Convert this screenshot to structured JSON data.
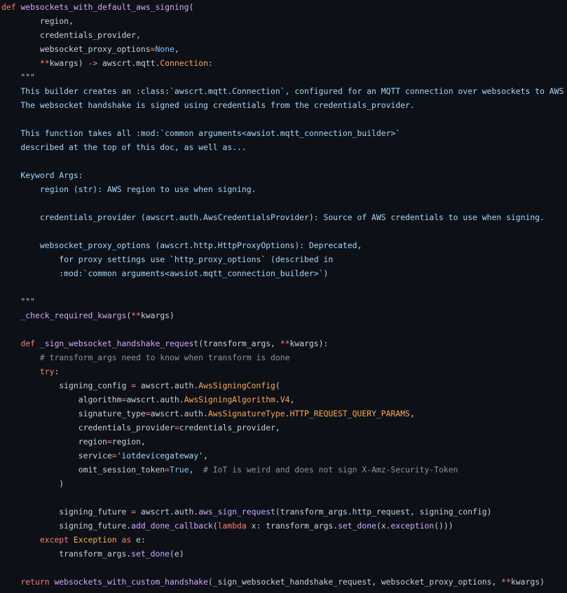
{
  "editor": {
    "background": "#0d1117",
    "token_colors": {
      "kw": "#ff7b72",
      "fn": "#d2a8ff",
      "txt": "#c9d1d9",
      "str": "#a5d6ff",
      "cmt": "#8b949e",
      "cst": "#79c0ff",
      "cls": "#ffa657"
    }
  },
  "lines": [
    [
      [
        "kw",
        "def"
      ],
      [
        "txt",
        " "
      ],
      [
        "fn",
        "websockets_with_default_aws_signing"
      ],
      [
        "txt",
        "("
      ]
    ],
    [
      [
        "txt",
        "        region,"
      ]
    ],
    [
      [
        "txt",
        "        credentials_provider,"
      ]
    ],
    [
      [
        "txt",
        "        websocket_proxy_options"
      ],
      [
        "kw",
        "="
      ],
      [
        "cst",
        "None"
      ],
      [
        "txt",
        ","
      ]
    ],
    [
      [
        "txt",
        "        "
      ],
      [
        "kw",
        "**"
      ],
      [
        "txt",
        "kwargs) "
      ],
      [
        "kw",
        "->"
      ],
      [
        "txt",
        " awscrt.mqtt."
      ],
      [
        "cls",
        "Connection"
      ],
      [
        "txt",
        ":"
      ]
    ],
    [
      [
        "str",
        "    \"\"\""
      ]
    ],
    [
      [
        "str",
        "    This builder creates an :class:`awscrt.mqtt.Connection`, configured for an MQTT connection over websockets to AWS IoT."
      ]
    ],
    [
      [
        "str",
        "    The websocket handshake is signed using credentials from the credentials_provider."
      ]
    ],
    [
      [
        "str",
        ""
      ]
    ],
    [
      [
        "str",
        "    This function takes all :mod:`common arguments<awsiot.mqtt_connection_builder>`"
      ]
    ],
    [
      [
        "str",
        "    described at the top of this doc, as well as..."
      ]
    ],
    [
      [
        "str",
        ""
      ]
    ],
    [
      [
        "str",
        "    Keyword Args:"
      ]
    ],
    [
      [
        "str",
        "        region (str): AWS region to use when signing."
      ]
    ],
    [
      [
        "str",
        ""
      ]
    ],
    [
      [
        "str",
        "        credentials_provider (awscrt.auth.AwsCredentialsProvider): Source of AWS credentials to use when signing."
      ]
    ],
    [
      [
        "str",
        ""
      ]
    ],
    [
      [
        "str",
        "        websocket_proxy_options (awscrt.http.HttpProxyOptions): Deprecated,"
      ]
    ],
    [
      [
        "str",
        "            for proxy settings use `http_proxy_options` (described in"
      ]
    ],
    [
      [
        "str",
        "            :mod:`common arguments<awsiot.mqtt_connection_builder>`)"
      ]
    ],
    [
      [
        "str",
        ""
      ]
    ],
    [
      [
        "str",
        "    \"\"\""
      ]
    ],
    [
      [
        "txt",
        "    "
      ],
      [
        "fn",
        "_check_required_kwargs"
      ],
      [
        "txt",
        "("
      ],
      [
        "kw",
        "**"
      ],
      [
        "txt",
        "kwargs)"
      ]
    ],
    [
      [
        "txt",
        ""
      ]
    ],
    [
      [
        "txt",
        "    "
      ],
      [
        "kw",
        "def"
      ],
      [
        "txt",
        " "
      ],
      [
        "fn",
        "_sign_websocket_handshake_request"
      ],
      [
        "txt",
        "(transform_args, "
      ],
      [
        "kw",
        "**"
      ],
      [
        "txt",
        "kwargs):"
      ]
    ],
    [
      [
        "txt",
        "        "
      ],
      [
        "cmt",
        "# transform_args need to know when transform is done"
      ]
    ],
    [
      [
        "txt",
        "        "
      ],
      [
        "kw",
        "try"
      ],
      [
        "txt",
        ":"
      ]
    ],
    [
      [
        "txt",
        "            signing_config "
      ],
      [
        "kw",
        "="
      ],
      [
        "txt",
        " awscrt.auth."
      ],
      [
        "cls",
        "AwsSigningConfig"
      ],
      [
        "txt",
        "("
      ]
    ],
    [
      [
        "txt",
        "                algorithm"
      ],
      [
        "kw",
        "="
      ],
      [
        "txt",
        "awscrt.auth."
      ],
      [
        "cls",
        "AwsSigningAlgorithm"
      ],
      [
        "txt",
        "."
      ],
      [
        "cls",
        "V4"
      ],
      [
        "txt",
        ","
      ]
    ],
    [
      [
        "txt",
        "                signature_type"
      ],
      [
        "kw",
        "="
      ],
      [
        "txt",
        "awscrt.auth."
      ],
      [
        "cls",
        "AwsSignatureType"
      ],
      [
        "txt",
        "."
      ],
      [
        "cls",
        "HTTP_REQUEST_QUERY_PARAMS"
      ],
      [
        "txt",
        ","
      ]
    ],
    [
      [
        "txt",
        "                credentials_provider"
      ],
      [
        "kw",
        "="
      ],
      [
        "txt",
        "credentials_provider,"
      ]
    ],
    [
      [
        "txt",
        "                region"
      ],
      [
        "kw",
        "="
      ],
      [
        "txt",
        "region,"
      ]
    ],
    [
      [
        "txt",
        "                service"
      ],
      [
        "kw",
        "="
      ],
      [
        "str",
        "'iotdevicegateway'"
      ],
      [
        "txt",
        ","
      ]
    ],
    [
      [
        "txt",
        "                omit_session_token"
      ],
      [
        "kw",
        "="
      ],
      [
        "cst",
        "True"
      ],
      [
        "txt",
        ",  "
      ],
      [
        "cmt",
        "# IoT is weird and does not sign X-Amz-Security-Token"
      ]
    ],
    [
      [
        "txt",
        "            )"
      ]
    ],
    [
      [
        "txt",
        ""
      ]
    ],
    [
      [
        "txt",
        "            signing_future "
      ],
      [
        "kw",
        "="
      ],
      [
        "txt",
        " awscrt.auth."
      ],
      [
        "fn",
        "aws_sign_request"
      ],
      [
        "txt",
        "(transform_args.http_request, signing_config)"
      ]
    ],
    [
      [
        "txt",
        "            signing_future."
      ],
      [
        "fn",
        "add_done_callback"
      ],
      [
        "txt",
        "("
      ],
      [
        "kw",
        "lambda"
      ],
      [
        "txt",
        " x: transform_args."
      ],
      [
        "fn",
        "set_done"
      ],
      [
        "txt",
        "(x."
      ],
      [
        "fn",
        "exception"
      ],
      [
        "txt",
        "()))"
      ]
    ],
    [
      [
        "txt",
        "        "
      ],
      [
        "kw",
        "except"
      ],
      [
        "txt",
        " "
      ],
      [
        "cls",
        "Exception"
      ],
      [
        "txt",
        " "
      ],
      [
        "kw",
        "as"
      ],
      [
        "txt",
        " e:"
      ]
    ],
    [
      [
        "txt",
        "            transform_args."
      ],
      [
        "fn",
        "set_done"
      ],
      [
        "txt",
        "(e)"
      ]
    ],
    [
      [
        "txt",
        ""
      ]
    ],
    [
      [
        "txt",
        "    "
      ],
      [
        "kw",
        "return"
      ],
      [
        "txt",
        " "
      ],
      [
        "fn",
        "websockets_with_custom_handshake"
      ],
      [
        "txt",
        "(_sign_websocket_handshake_request, websocket_proxy_options, "
      ],
      [
        "kw",
        "**"
      ],
      [
        "txt",
        "kwargs)"
      ]
    ]
  ]
}
